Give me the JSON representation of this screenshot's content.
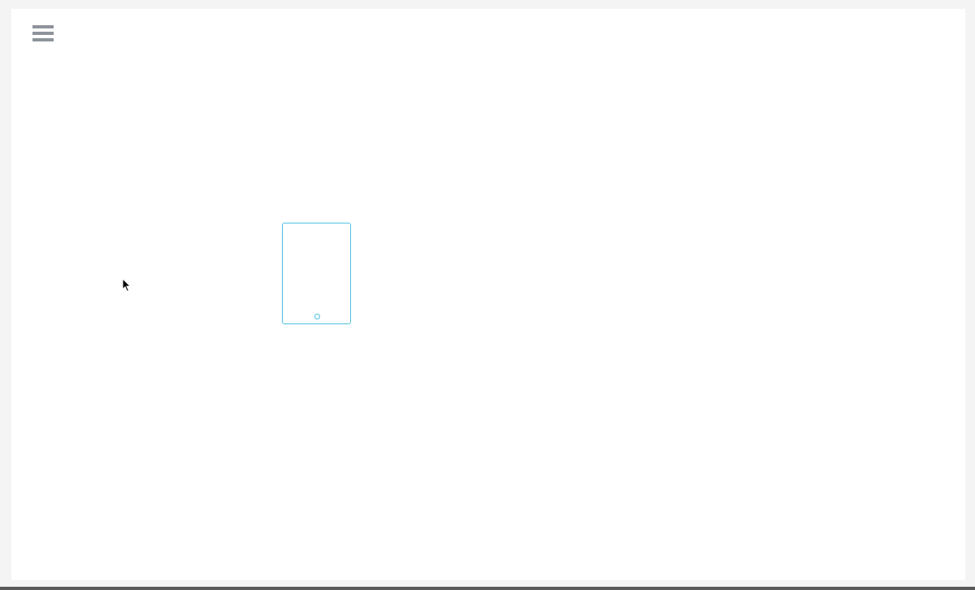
{
  "colors": {
    "accent": "#4ec0df",
    "menu_icon": "#8e939b",
    "canvas_background": "#ffffff",
    "page_background": "#f4f4f4"
  },
  "icons": {
    "menu": "hamburger-menu-icon",
    "device": "tablet-icon",
    "pointer": "mouse-pointer-icon"
  }
}
